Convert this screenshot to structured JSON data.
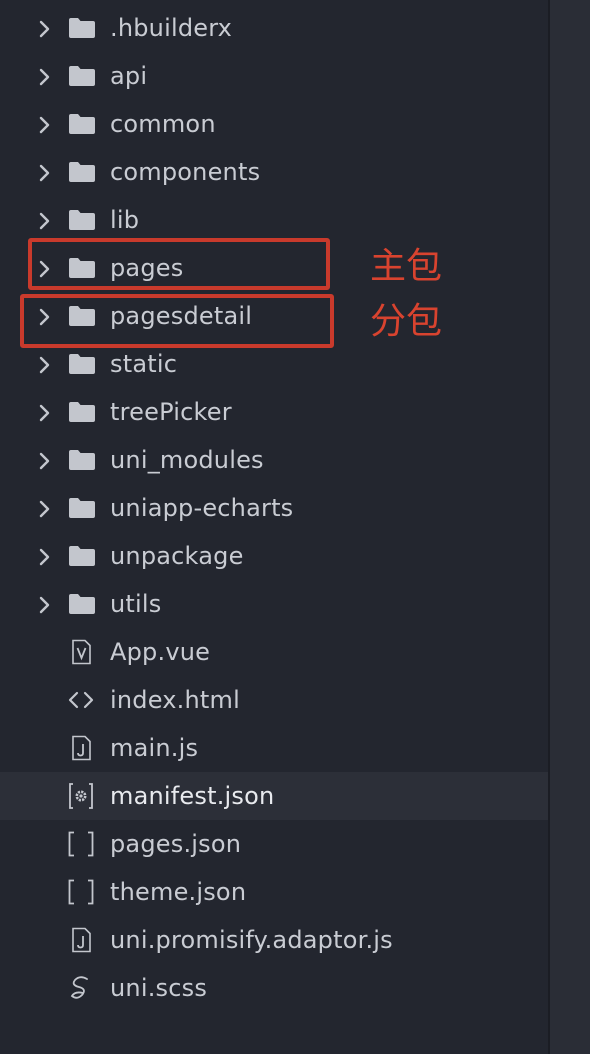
{
  "explorer": {
    "items": [
      {
        "label": ".hbuilderx",
        "kind": "folder",
        "icon": "folder-icon"
      },
      {
        "label": "api",
        "kind": "folder",
        "icon": "folder-icon"
      },
      {
        "label": "common",
        "kind": "folder",
        "icon": "folder-icon"
      },
      {
        "label": "components",
        "kind": "folder",
        "icon": "folder-icon"
      },
      {
        "label": "lib",
        "kind": "folder",
        "icon": "folder-icon"
      },
      {
        "label": "pages",
        "kind": "folder",
        "icon": "folder-icon"
      },
      {
        "label": "pagesdetail",
        "kind": "folder",
        "icon": "folder-icon"
      },
      {
        "label": "static",
        "kind": "folder",
        "icon": "folder-icon"
      },
      {
        "label": "treePicker",
        "kind": "folder",
        "icon": "folder-icon"
      },
      {
        "label": "uni_modules",
        "kind": "folder",
        "icon": "folder-icon"
      },
      {
        "label": "uniapp-echarts",
        "kind": "folder",
        "icon": "folder-icon"
      },
      {
        "label": "unpackage",
        "kind": "folder",
        "icon": "folder-icon"
      },
      {
        "label": "utils",
        "kind": "folder",
        "icon": "folder-icon"
      },
      {
        "label": "App.vue",
        "kind": "file",
        "icon": "vue-file-icon"
      },
      {
        "label": "index.html",
        "kind": "file",
        "icon": "html-file-icon"
      },
      {
        "label": "main.js",
        "kind": "file",
        "icon": "js-file-icon"
      },
      {
        "label": "manifest.json",
        "kind": "file",
        "icon": "settings-file-icon",
        "selected": true
      },
      {
        "label": "pages.json",
        "kind": "file",
        "icon": "json-file-icon"
      },
      {
        "label": "theme.json",
        "kind": "file",
        "icon": "json-file-icon"
      },
      {
        "label": "uni.promisify.adaptor.js",
        "kind": "file",
        "icon": "js-file-icon"
      },
      {
        "label": "uni.scss",
        "kind": "file",
        "icon": "scss-file-icon"
      }
    ]
  },
  "annotations": {
    "main_package": "主包",
    "sub_package": "分包",
    "color": "#d8432f"
  },
  "colors": {
    "background": "#23262f",
    "text": "#c9ccd3",
    "icon": "#c3c6cd",
    "selected_row": "#2c2f38",
    "highlight": "#c93a2c"
  }
}
